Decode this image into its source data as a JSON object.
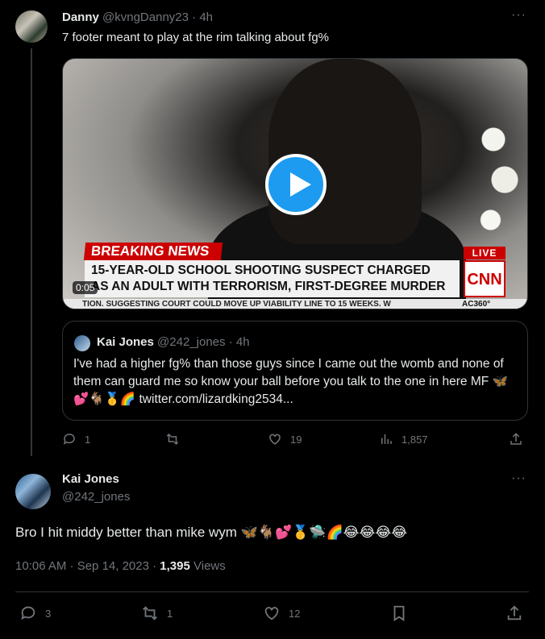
{
  "tweet": {
    "author_name": "Danny",
    "author_handle": "@kvngDanny23",
    "time": "· 4h",
    "text": "7 footer meant to play at the rim talking about fg%",
    "video": {
      "breaking_label": "BREAKING NEWS",
      "live_label": "LIVE",
      "headline_line1": "15-YEAR-OLD SCHOOL SHOOTING SUSPECT CHARGED",
      "headline_line2": "AS AN ADULT WITH TERRORISM, FIRST-DEGREE MURDER",
      "network": "CNN",
      "ticker": "TION. SUGGESTING COURT COULD MOVE UP VIABILITY LINE TO 15 WEEKS. W",
      "show": "AC360°",
      "duration": "0:05"
    },
    "quoted": {
      "author_name": "Kai Jones",
      "author_handle": "@242_jones",
      "time": "· 4h",
      "text": "I've had a higher fg% than those guys since I came out the womb and none of them can guard me so know your ball before you talk to the one in here MF 🦋💕🐐🥇🌈 twitter.com/lizardking2534..."
    },
    "actions": {
      "replies": "1",
      "likes": "19",
      "views": "1,857"
    }
  },
  "reply": {
    "author_name": "Kai Jones",
    "author_handle": "@242_jones",
    "text": "Bro I hit middy better than mike wym 🦋🐐💕🥇🛸🌈😂😂😂😂",
    "timestamp": "10:06 AM · Sep 14, 2023 ·",
    "views_count": "1,395",
    "views_label": "Views",
    "actions": {
      "replies": "3",
      "retweets": "1",
      "likes": "12"
    }
  },
  "icons": [
    "more-icon",
    "reply-icon",
    "retweet-icon",
    "like-icon",
    "views-icon",
    "share-icon",
    "bookmark-icon",
    "play-icon"
  ],
  "colors": {
    "accent": "#1d9bf0",
    "background": "#000000",
    "muted": "#71767b"
  }
}
